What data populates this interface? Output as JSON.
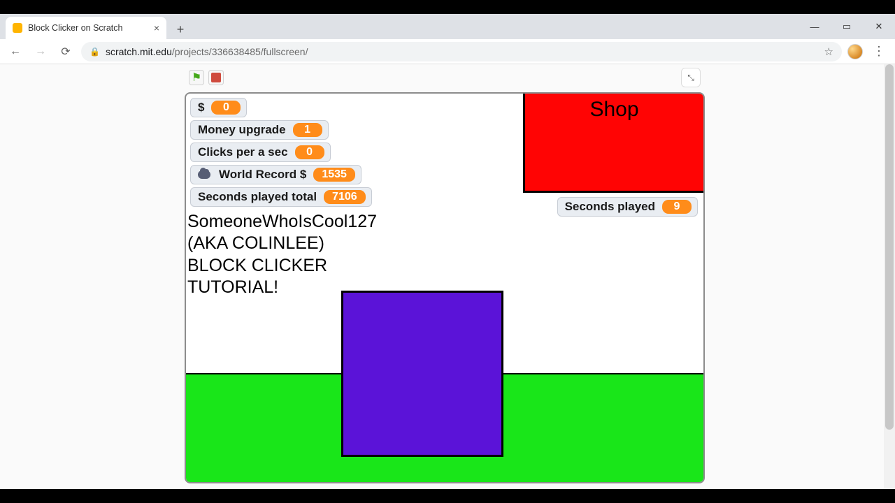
{
  "browser": {
    "tab_title": "Block Clicker on Scratch",
    "url_host": "scratch.mit.edu",
    "url_path": "/projects/336638485/fullscreen/",
    "new_tab": "+",
    "close_tab": "×",
    "win_min": "—",
    "win_max": "▭",
    "win_close": "✕",
    "kebab": "⋮",
    "star": "☆",
    "lock": "🔒"
  },
  "player": {
    "green_flag_glyph": "⚑",
    "exit_fs_glyph": "⤡"
  },
  "game": {
    "shop_label": "Shop",
    "credits_text": "SomeoneWhoIsCool127\n(AKA COLINLEE)\nBLOCK CLICKER\nTUTORIAL!",
    "monitors": {
      "money": {
        "label": "$",
        "value": "0"
      },
      "money_upgrade": {
        "label": "Money upgrade",
        "value": "1"
      },
      "clicks_per_sec": {
        "label": "Clicks per a sec",
        "value": "0"
      },
      "world_record": {
        "label": "World Record $",
        "value": "1535"
      },
      "seconds_total": {
        "label": "Seconds played total",
        "value": "7106"
      },
      "seconds_played": {
        "label": "Seconds played",
        "value": "9"
      }
    }
  }
}
